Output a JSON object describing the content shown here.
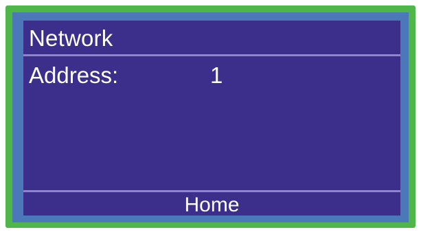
{
  "screen": {
    "title": "Network",
    "fields": [
      {
        "label": "Address:",
        "value": "1"
      }
    ],
    "softkey": {
      "label": "Home"
    }
  },
  "colors": {
    "frame_outer": "#4fb74a",
    "frame_inner": "#4a78b8",
    "screen_bg": "#3b2f8b",
    "divider": "#8f86c3",
    "text": "#ffffff"
  }
}
